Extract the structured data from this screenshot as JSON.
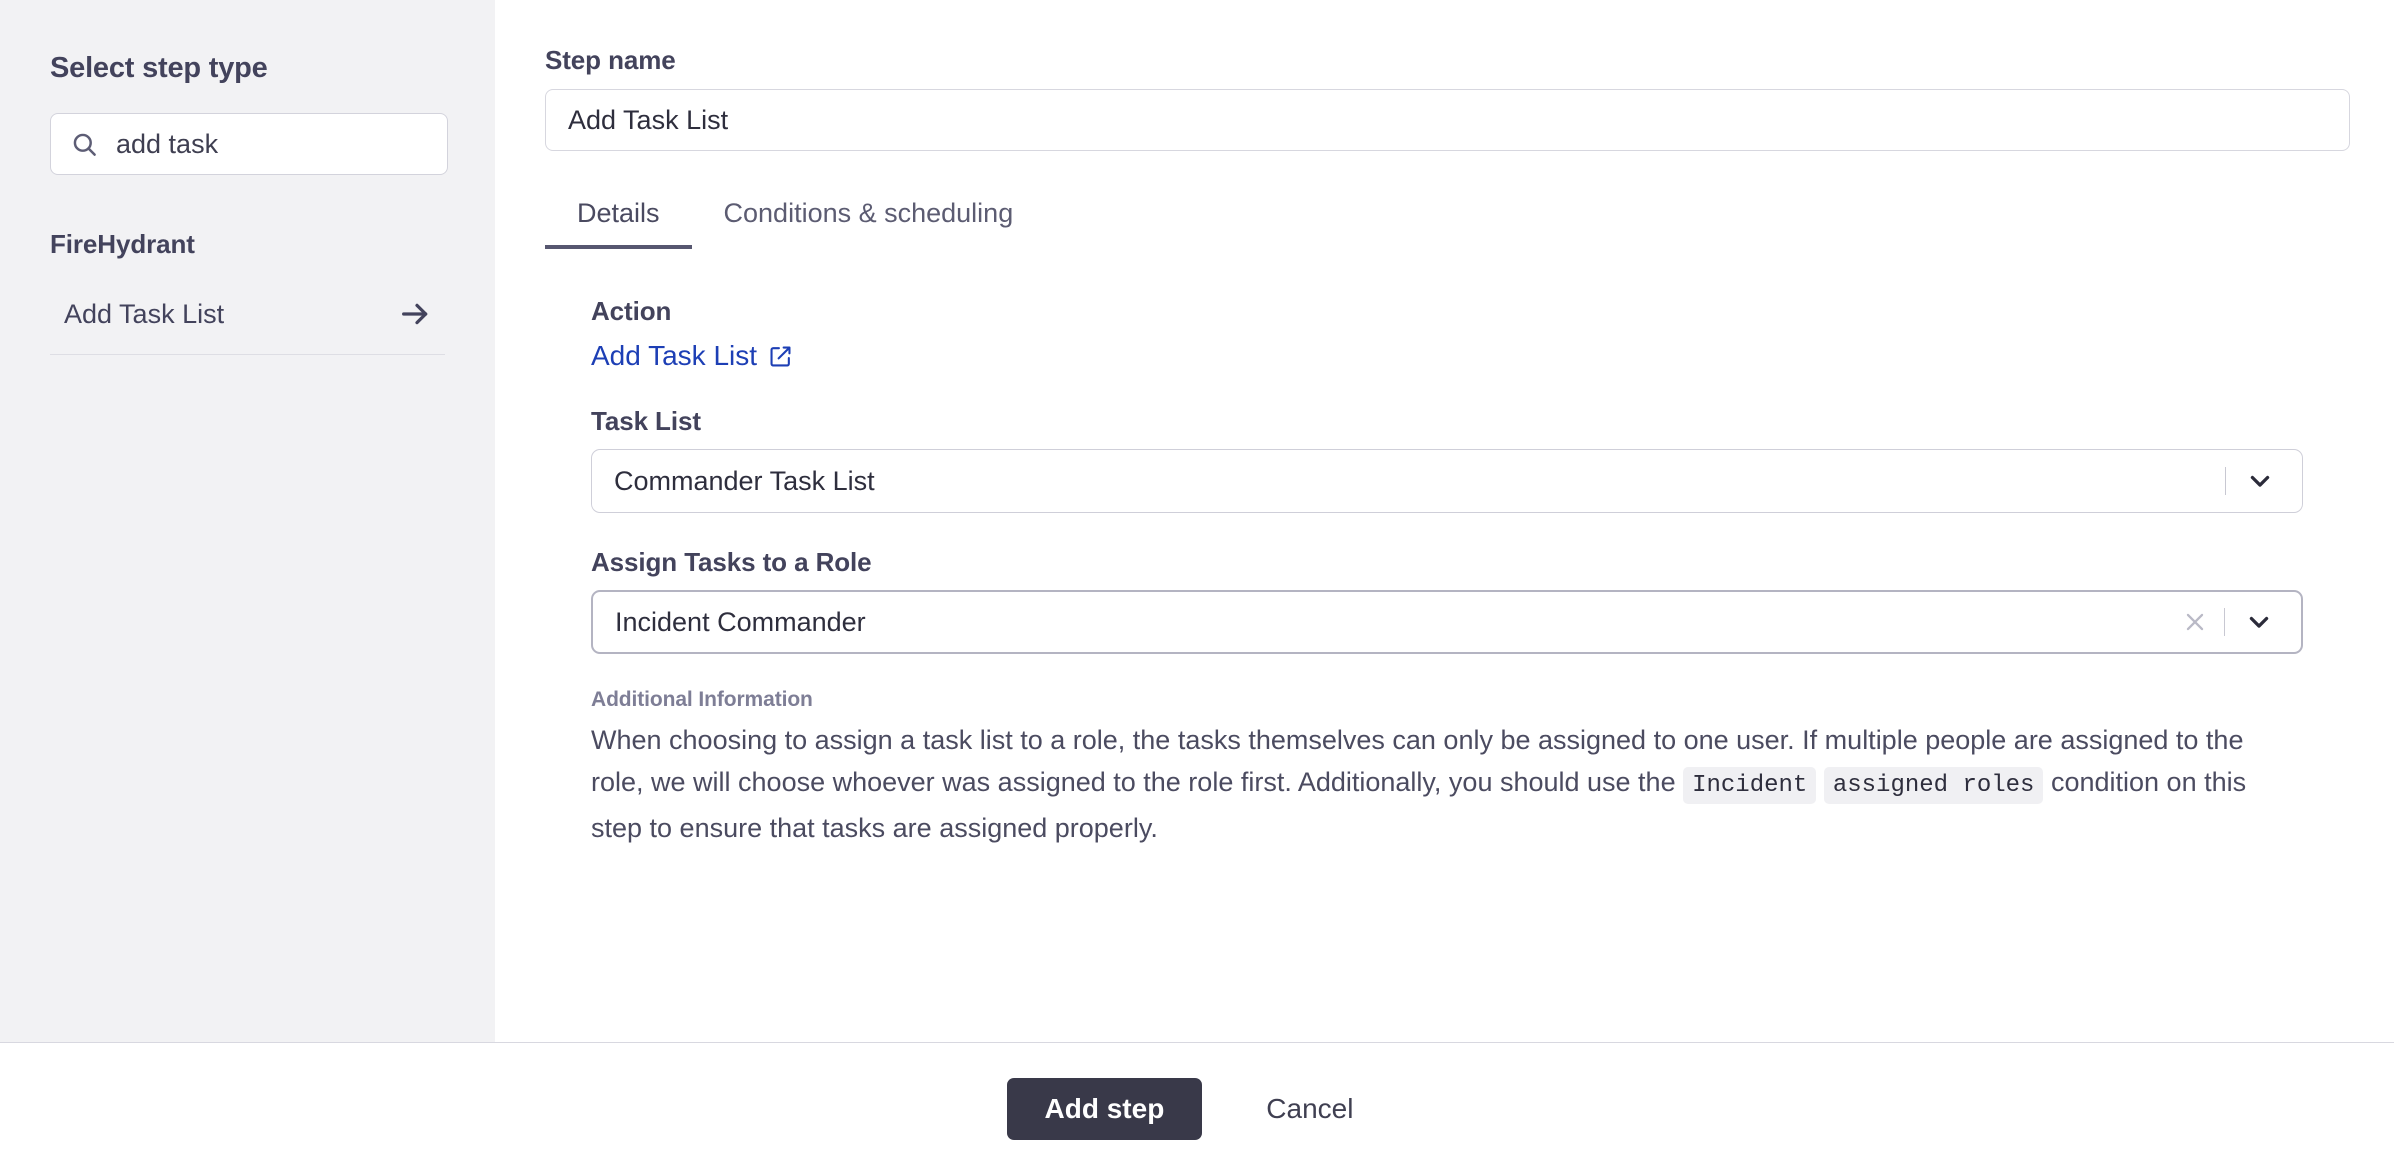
{
  "sidebar": {
    "title": "Select step type",
    "search": {
      "icon": "search-icon",
      "value": "add task",
      "placeholder": "Search step types"
    },
    "group_title": "FireHydrant",
    "items": [
      {
        "label": "Add Task List",
        "icon": "arrow-right-icon"
      }
    ]
  },
  "main": {
    "step_name": {
      "label": "Step name",
      "value": "Add Task List",
      "placeholder": "Step name"
    },
    "tabs": [
      {
        "label": "Details",
        "active": true
      },
      {
        "label": "Conditions & scheduling",
        "active": false
      }
    ],
    "details": {
      "action": {
        "label": "Action",
        "link_text": "Add Task List",
        "link_icon": "external-link-icon"
      },
      "task_list": {
        "label": "Task List",
        "value": "Commander Task List",
        "chevron_icon": "chevron-down-icon"
      },
      "assign_role": {
        "label": "Assign Tasks to a Role",
        "value": "Incident Commander",
        "clear_icon": "close-icon",
        "chevron_icon": "chevron-down-icon",
        "focused": true
      },
      "additional_information": {
        "title": "Additional Information",
        "text_part_1": "When choosing to assign a task list to a role, the tasks themselves can only be assigned to one user. If multiple people are assigned to the role, we will choose whoever was assigned to the role first. Additionally, you should use the ",
        "code_1": "Incident",
        "text_part_2": " ",
        "code_2": "assigned roles",
        "text_part_3": " condition on this step to ensure that tasks are assigned properly."
      }
    }
  },
  "footer": {
    "primary_label": "Add step",
    "cancel_label": "Cancel"
  },
  "colors": {
    "sidebar_background": "#f2f2f4",
    "link_blue": "#1d3fb5",
    "primary_button": "#393949",
    "muted_heading": "#7e7e96",
    "text": "#43435c"
  }
}
